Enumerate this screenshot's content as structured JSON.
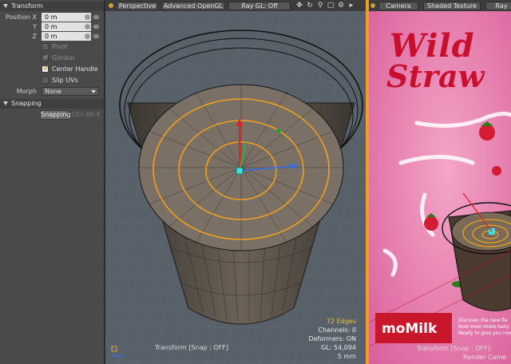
{
  "transform_panel": {
    "title": "Transform",
    "position_x_label": "Position X",
    "y_label": "Y",
    "z_label": "Z",
    "position_x_value": "0 m",
    "position_y_value": "0 m",
    "position_z_value": "0 m",
    "pivot_label": "Pivot",
    "gimbal_label": "Gimbal",
    "center_handle_label": "Center Handle",
    "slip_uvs_label": "Slip UVs",
    "morph_label": "Morph",
    "morph_value": "None"
  },
  "snapping_panel": {
    "title": "Snapping",
    "snapping_button_label": "Snapping",
    "snapping_shortcut": "Ctrl-Alt-X"
  },
  "viewport_left": {
    "projection_label": "Perspective",
    "shading_label": "Advanced OpenGL",
    "raygl_label": "Ray GL: Off",
    "icons": [
      "move-icon",
      "rotate-icon",
      "zoom-icon",
      "fit-icon",
      "gear-icon",
      "expand-icon"
    ],
    "hud": {
      "edges": "72 Edges",
      "channels": "Channels: 0",
      "deformers": "Deformers: ON",
      "gl": "GL: 54,094",
      "grid": "5 mm"
    },
    "tool_label": "Transform  [Snap : OFF]"
  },
  "viewport_right": {
    "camera_label": "Camera",
    "shading_label": "Shaded Texture",
    "raygl_label": "Ray",
    "poster_line1": "Wild",
    "poster_line2": "Straw",
    "poster_brand": "moMilk",
    "poster_copy1": "Discover the new fla",
    "poster_copy2": "Now even more tasty",
    "poster_copy3": "Ready to give you new",
    "tool_label": "Transform  [Snap : OFF]",
    "camera_tag": "Render Came"
  },
  "colors": {
    "accent_orange": "#f0a020",
    "poster_pink": "#e37aa9",
    "brand_red": "#c8172b"
  }
}
